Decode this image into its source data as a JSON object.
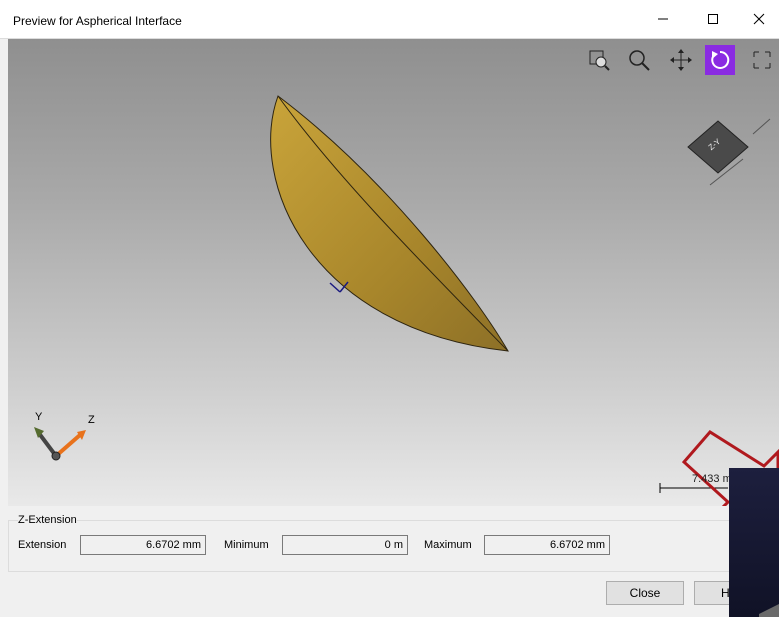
{
  "window": {
    "title": "Preview for Aspherical Interface"
  },
  "viewport": {
    "axis_y_label": "Y",
    "axis_z_label": "Z",
    "view_cube_label": "Z-Y",
    "scale_label": "7.433 m"
  },
  "toolbar": {
    "icons": [
      "zoom-to-fit-icon",
      "zoom-icon",
      "pan-icon",
      "rotate-icon",
      "fullscreen-icon"
    ],
    "active": "rotate-icon",
    "active_color": "#8a2be2"
  },
  "z_extension": {
    "group_title": "Z-Extension",
    "extension_label": "Extension",
    "extension_value": "6.6702 mm",
    "minimum_label": "Minimum",
    "minimum_value": "0 m",
    "maximum_label": "Maximum",
    "maximum_value": "6.6702 mm"
  },
  "buttons": {
    "close_label": "Close",
    "help_label": "H"
  },
  "colors": {
    "lens_fill": "#b8902e",
    "arrow_red": "#b0191e",
    "overlay_dark": "#1d1f3e"
  }
}
